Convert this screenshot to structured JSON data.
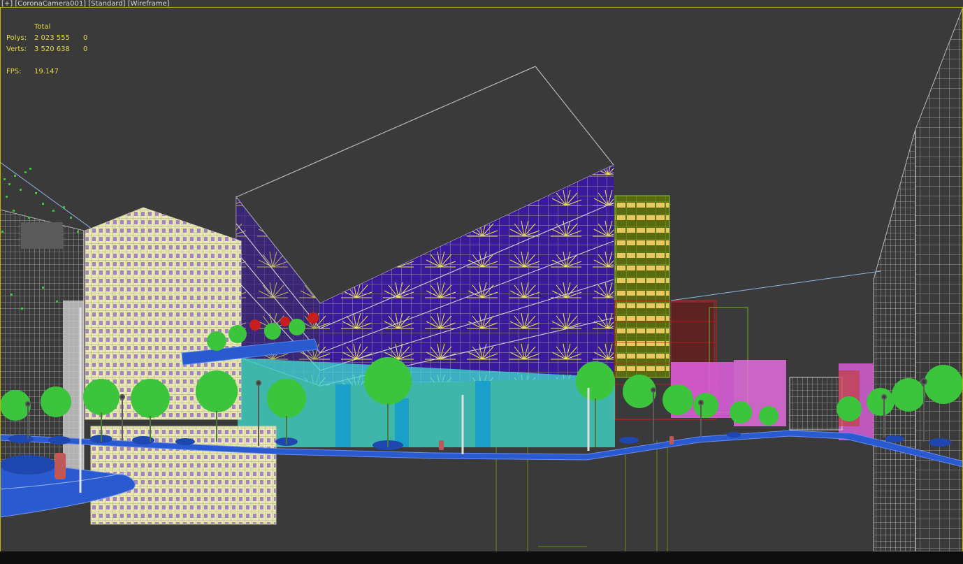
{
  "viewport": {
    "label_parts": [
      "[+]",
      "[CoronaCamera001]",
      "[Standard]",
      "[Wireframe]"
    ],
    "border_color": "#c8b400",
    "background_color": "#3a3a3a"
  },
  "stats": {
    "header": "Total",
    "polys_label": "Polys:",
    "polys_total": "2 023 555",
    "polys_selected": "0",
    "verts_label": "Verts:",
    "verts_total": "3 520 638",
    "verts_selected": "0",
    "fps_label": "FPS:",
    "fps_value": "19.147",
    "text_color": "#e6d84a"
  },
  "scene": {
    "description_icons": [
      "wireframe-building",
      "tree",
      "street-lamp",
      "car",
      "fire-hydrant"
    ],
    "colors": {
      "wire_gray": "#9a9a9a",
      "glass_purple": "#3a1a9a",
      "plant_yellow": "#e8e040",
      "tree_green": "#3cc43c",
      "cyan_glass": "#40e0d0",
      "road_blue": "#2a5ad0",
      "cream_building": "#e6e6a8",
      "magenta": "#e060e0",
      "red": "#c81e1e",
      "olive": "#6aa020",
      "orange_yellow": "#e8c860"
    }
  }
}
